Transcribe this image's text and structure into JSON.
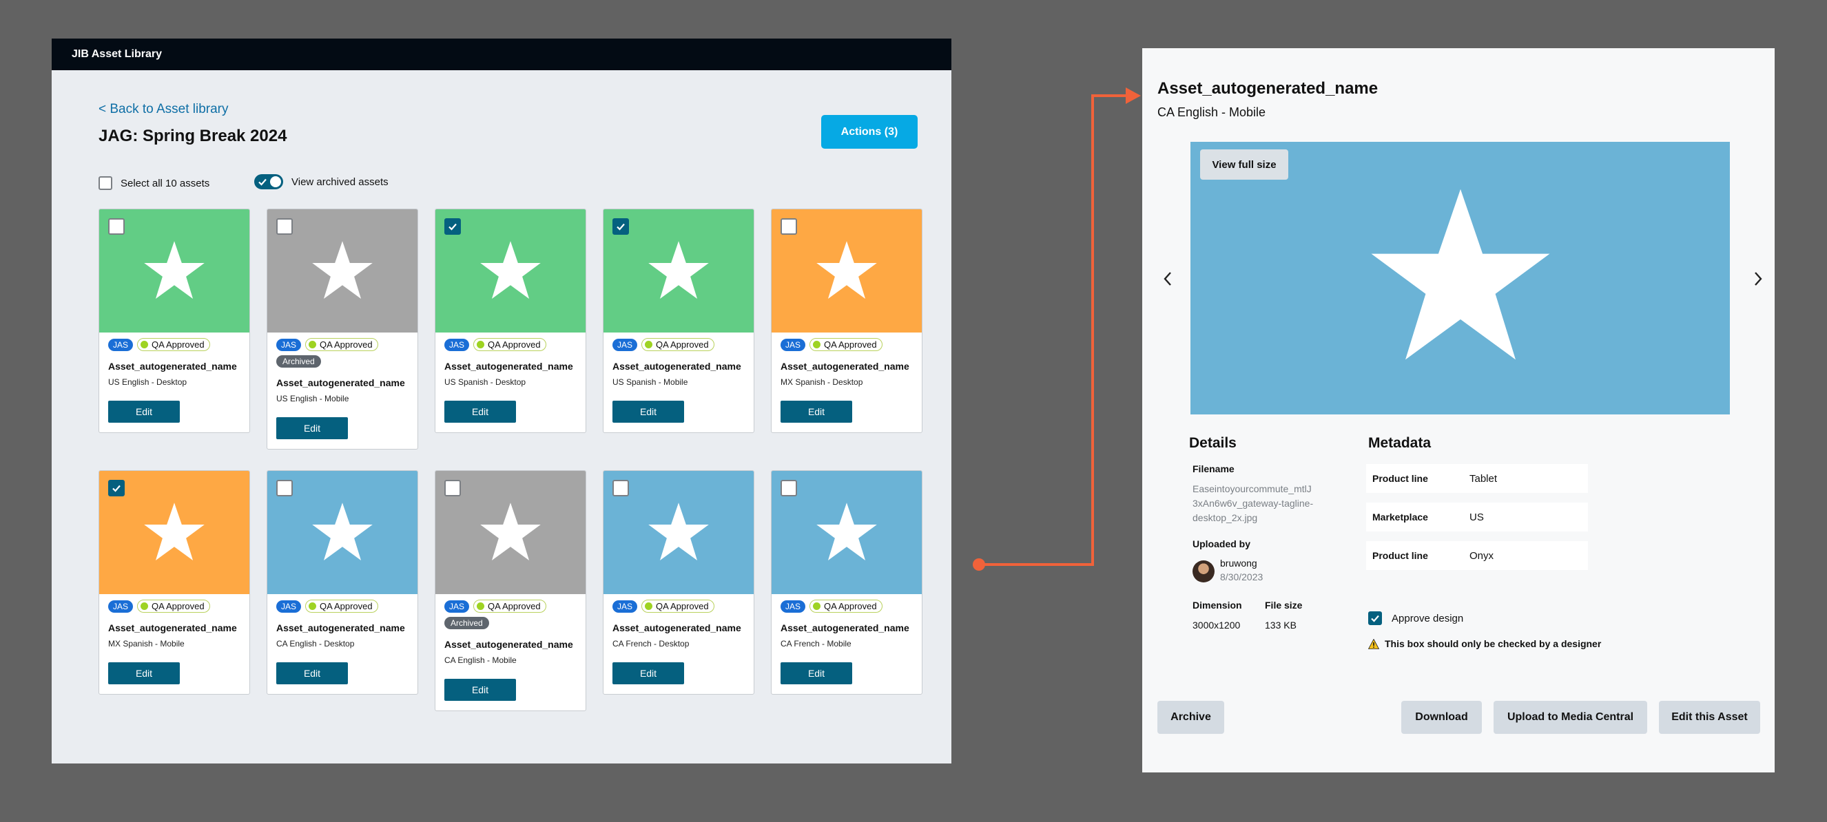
{
  "library": {
    "app_title": "JIB Asset Library",
    "back_link": "< Back to Asset library",
    "page_title": "JAG: Spring Break 2024",
    "actions_label": "Actions (3)",
    "select_all_label": "Select all 10 assets",
    "view_archived_label": "View archived assets",
    "view_archived_on": true,
    "cards": [
      {
        "color": "#62cd85",
        "checked": false,
        "archived": false,
        "tag": "JAS",
        "status": "QA Approved",
        "name": "Asset_autogenerated_name",
        "locale": "US English - Desktop",
        "edit": "Edit"
      },
      {
        "color": "#a5a5a5",
        "checked": false,
        "archived": true,
        "archived_label": "Archived",
        "tag": "JAS",
        "status": "QA Approved",
        "name": "Asset_autogenerated_name",
        "locale": "US English - Mobile",
        "edit": "Edit"
      },
      {
        "color": "#62cd85",
        "checked": true,
        "archived": false,
        "tag": "JAS",
        "status": "QA Approved",
        "name": "Asset_autogenerated_name",
        "locale": "US Spanish - Desktop",
        "edit": "Edit"
      },
      {
        "color": "#62cd85",
        "checked": true,
        "archived": false,
        "tag": "JAS",
        "status": "QA Approved",
        "name": "Asset_autogenerated_name",
        "locale": "US Spanish - Mobile",
        "edit": "Edit"
      },
      {
        "color": "#fea844",
        "checked": false,
        "archived": false,
        "tag": "JAS",
        "status": "QA Approved",
        "name": "Asset_autogenerated_name",
        "locale": "MX Spanish - Desktop",
        "edit": "Edit"
      },
      {
        "color": "#fea844",
        "checked": true,
        "archived": false,
        "tag": "JAS",
        "status": "QA Approved",
        "name": "Asset_autogenerated_name",
        "locale": "MX Spanish - Mobile",
        "edit": "Edit"
      },
      {
        "color": "#6bb3d6",
        "checked": false,
        "archived": false,
        "tag": "JAS",
        "status": "QA Approved",
        "name": "Asset_autogenerated_name",
        "locale": "CA English - Desktop",
        "edit": "Edit"
      },
      {
        "color": "#a5a5a5",
        "checked": false,
        "archived": true,
        "archived_label": "Archived",
        "tag": "JAS",
        "status": "QA Approved",
        "name": "Asset_autogenerated_name",
        "locale": "CA English - Mobile",
        "edit": "Edit"
      },
      {
        "color": "#6bb3d6",
        "checked": false,
        "archived": false,
        "tag": "JAS",
        "status": "QA Approved",
        "name": "Asset_autogenerated_name",
        "locale": "CA French - Desktop",
        "edit": "Edit"
      },
      {
        "color": "#6bb3d6",
        "checked": false,
        "archived": false,
        "tag": "JAS",
        "status": "QA Approved",
        "name": "Asset_autogenerated_name",
        "locale": "CA French - Mobile",
        "edit": "Edit"
      }
    ]
  },
  "detail": {
    "title": "Asset_autogenerated_name",
    "subtitle": "CA English - Mobile",
    "preview_color": "#6bb3d6",
    "view_full_label": "View full size",
    "details_heading": "Details",
    "filename_label": "Filename",
    "filename_value": "Easeintoyourcommute_mtlJ3xAn6w6v_gateway-tagline-desktop_2x.jpg",
    "uploaded_by_label": "Uploaded by",
    "uploader_name": "bruwong",
    "upload_date": "8/30/2023",
    "dimension_label": "Dimension",
    "dimension_value": "3000x1200",
    "filesize_label": "File size",
    "filesize_value": "133 KB",
    "metadata_heading": "Metadata",
    "metadata": [
      {
        "key": "Product line",
        "value": "Tablet"
      },
      {
        "key": "Marketplace",
        "value": "US"
      },
      {
        "key": "Product line",
        "value": "Onyx"
      }
    ],
    "approve_label": "Approve design",
    "approve_checked": true,
    "warning_text": "This box should only be checked by a designer",
    "buttons": {
      "archive": "Archive",
      "download": "Download",
      "upload": "Upload to Media Central",
      "edit": "Edit this Asset"
    }
  },
  "colors": {
    "accent": "#05607f",
    "actions": "#06a9e4",
    "connector": "#f0623a"
  }
}
